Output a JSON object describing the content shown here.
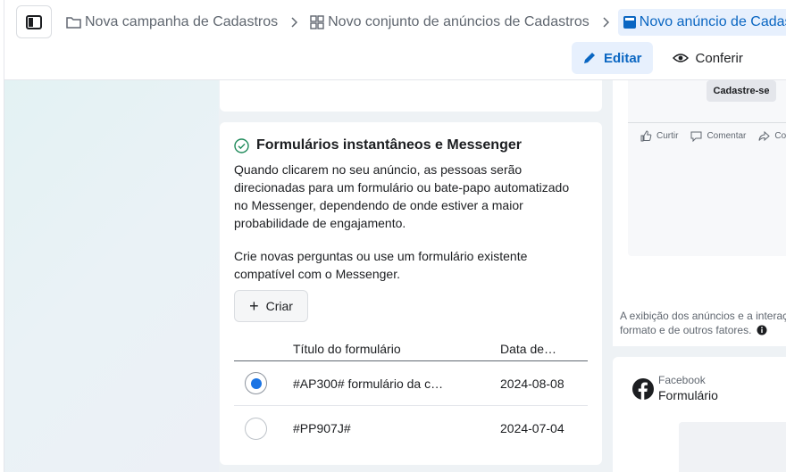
{
  "breadcrumb": {
    "campaign": "Nova campanha de Cadastros",
    "ad_set": "Novo conjunto de anúncios de Cadastros",
    "ad": "Novo anúncio de Cadastr"
  },
  "tabs": {
    "edit": "Editar",
    "review": "Conferir"
  },
  "form_card": {
    "title": "Formulários instantâneos e Messenger",
    "description": "Quando clicarem no seu anúncio, as pessoas serão direcionadas para um formulário ou bate-papo automatizado no Messenger, dependendo de onde estiver a maior probabilidade de engajamento.",
    "instruction": "Crie novas perguntas ou use um formulário existente compatível com o Messenger.",
    "create_button": "Criar",
    "table": {
      "headers": {
        "title": "Título do formulário",
        "date": "Data de…"
      },
      "rows": [
        {
          "title": "#AP300# formulário da c…",
          "date": "2024-08-08",
          "selected": true
        },
        {
          "title": "#PP907J#",
          "date": "2024-07-04",
          "selected": false
        }
      ]
    }
  },
  "preview": {
    "cta_button": "Cadastre-se",
    "actions": {
      "like": "Curtir",
      "comment": "Comentar",
      "share": "Cor"
    },
    "note_line1": "A exibição dos anúncios e a interaç",
    "note_line2": "formato e de outros fatores.",
    "placement": {
      "platform": "Facebook",
      "type": "Formulário"
    }
  },
  "colors": {
    "accent": "#1b74e4",
    "active_tab_bg": "#e7f0fd",
    "active_text": "#0a66c2"
  }
}
